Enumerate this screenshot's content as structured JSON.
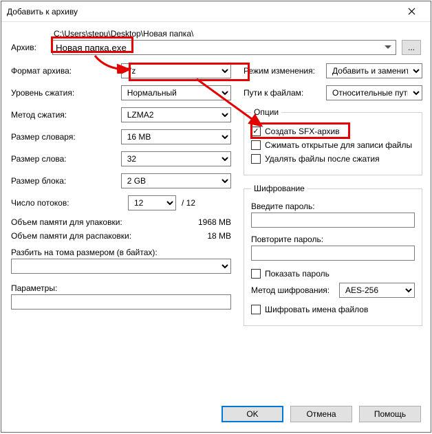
{
  "window": {
    "title": "Добавить к архиву"
  },
  "archive": {
    "label": "Архив:",
    "path": "C:\\Users\\stepu\\Desktop\\Новая папка\\",
    "filename": "Новая папка.exe",
    "browse": "..."
  },
  "left": {
    "format_label": "Формат архива:",
    "format_value": "7z",
    "level_label": "Уровень сжатия:",
    "level_value": "Нормальный",
    "method_label": "Метод сжатия:",
    "method_value": "LZMA2",
    "dict_label": "Размер словаря:",
    "dict_value": "16 MB",
    "word_label": "Размер слова:",
    "word_value": "32",
    "block_label": "Размер блока:",
    "block_value": "2 GB",
    "threads_label": "Число потоков:",
    "threads_value": "12",
    "threads_total": "/ 12",
    "mem_pack_label": "Объем памяти для упаковки:",
    "mem_pack_value": "1968 MB",
    "mem_unpack_label": "Объем памяти для распаковки:",
    "mem_unpack_value": "18 MB",
    "split_label": "Разбить на тома размером (в байтах):",
    "split_value": "",
    "params_label": "Параметры:",
    "params_value": ""
  },
  "right": {
    "update_label": "Режим изменения:",
    "update_value": "Добавить и заменить",
    "paths_label": "Пути к файлам:",
    "paths_value": "Относительные пути",
    "options_legend": "Опции",
    "sfx_label": "Создать SFX-архив",
    "sfx_checked": true,
    "shared_label": "Сжимать открытые для записи файлы",
    "shared_checked": false,
    "delete_label": "Удалять файлы после сжатия",
    "delete_checked": false,
    "enc_legend": "Шифрование",
    "pw_label": "Введите пароль:",
    "pw_value": "",
    "pw2_label": "Повторите пароль:",
    "pw2_value": "",
    "show_pw_label": "Показать пароль",
    "show_pw_checked": false,
    "enc_method_label": "Метод шифрования:",
    "enc_method_value": "AES-256",
    "enc_names_label": "Шифровать имена файлов",
    "enc_names_checked": false
  },
  "footer": {
    "ok": "OK",
    "cancel": "Отмена",
    "help": "Помощь"
  },
  "annotations": {
    "color": "#e30000"
  }
}
